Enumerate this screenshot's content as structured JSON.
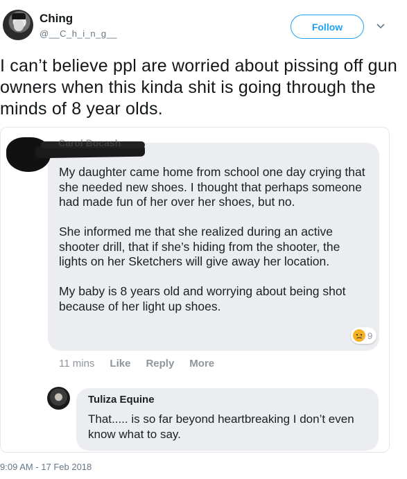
{
  "header": {
    "display_name": "Ching",
    "handle": "@__C_h_i_n_g__",
    "follow_label": "Follow",
    "caret_icon": "chevron-down-icon"
  },
  "tweet": {
    "text": "I can’t believe ppl are worried about pissing off gun owners when this kinda shit is going through the minds of 8 year olds.",
    "timestamp": "9:09 AM - 17 Feb 2018"
  },
  "screenshot": {
    "post": {
      "commenter_name": "Carol Bocash",
      "paragraphs": [
        "My daughter came home from school one day crying that she needed new shoes. I thought that perhaps someone had made fun of her over her shoes, but no.",
        "She informed me that she realized during an active shooter drill, that if she’s hiding from the shooter, the lights on her Sketchers will give away her location.",
        "My baby is 8 years old and worrying about being shot because of her light up shoes."
      ],
      "reaction_icon": "sad-face-emoji-icon",
      "reaction_count": "9",
      "actions": {
        "time": "11 mins",
        "like": "Like",
        "reply": "Reply",
        "more": "More"
      }
    },
    "reply": {
      "name": "Tuliza Equine",
      "text": "That..... is so far beyond heartbreaking I don’t even know what to say."
    }
  },
  "colors": {
    "accent": "#1da1f2",
    "bubble": "#ebedf0",
    "meta_gray": "#90949c"
  }
}
